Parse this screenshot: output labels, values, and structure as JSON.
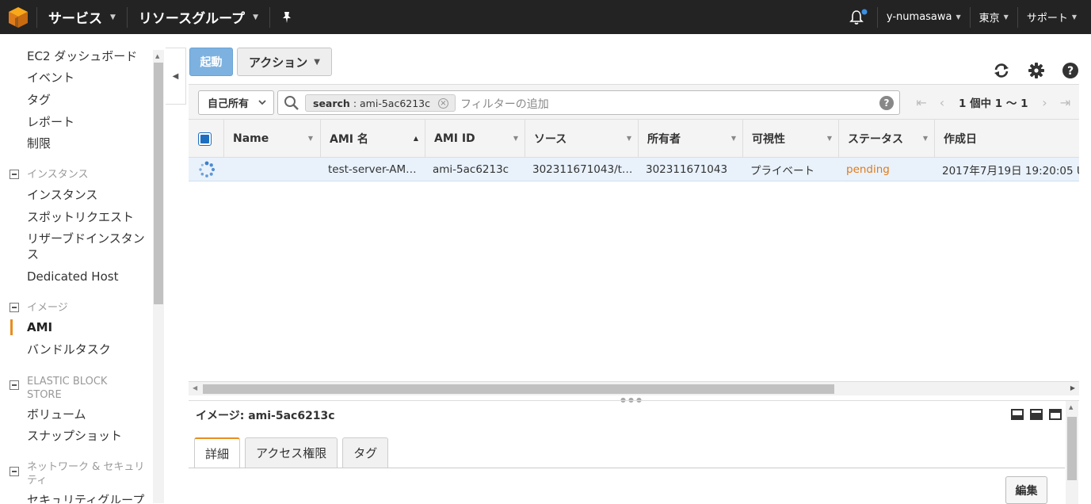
{
  "topbar": {
    "services": "サービス",
    "resource_groups": "リソースグループ",
    "user": "y-numasawa",
    "region": "東京",
    "support": "サポート"
  },
  "sidebar": {
    "items": [
      "EC2 ダッシュボード",
      "イベント",
      "タグ",
      "レポート",
      "制限"
    ],
    "instances_section": "インスタンス",
    "instances_items": [
      "インスタンス",
      "スポットリクエスト",
      "リザーブドインスタンス",
      "Dedicated Host"
    ],
    "images_section": "イメージ",
    "images_items": [
      "AMI",
      "バンドルタスク"
    ],
    "ebs_section": "ELASTIC BLOCK STORE",
    "ebs_items": [
      "ボリューム",
      "スナップショット"
    ],
    "network_section": "ネットワーク & セキュリティ",
    "network_items": [
      "セキュリティグループ"
    ]
  },
  "toolbar": {
    "launch": "起動",
    "actions": "アクション"
  },
  "filter": {
    "owner": "自己所有",
    "token_key": "search",
    "token_value": ": ami-5ac6213c",
    "placeholder": "フィルターの追加",
    "pager_text": "1 個中 1 ～ 1"
  },
  "table": {
    "columns": [
      "Name",
      "AMI 名",
      "AMI ID",
      "ソース",
      "所有者",
      "可視性",
      "ステータス",
      "作成日"
    ],
    "rows": [
      {
        "name": "",
        "ami_name": "test-server-AM…",
        "ami_id": "ami-5ac6213c",
        "source": "302311671043/t…",
        "owner": "302311671043",
        "visibility": "プライベート",
        "status": "pending",
        "created": "2017年7月19日 19:20:05 U"
      }
    ]
  },
  "detail": {
    "title": "イメージ: ami-5ac6213c",
    "tabs": [
      "詳細",
      "アクセス権限",
      "タグ"
    ],
    "edit": "編集"
  },
  "colors": {
    "topbar": "#232323",
    "accent_orange": "#e88e20",
    "launch_blue": "#7db2e0",
    "selected_row": "#e9f2fb",
    "pending": "#e07b1a"
  }
}
